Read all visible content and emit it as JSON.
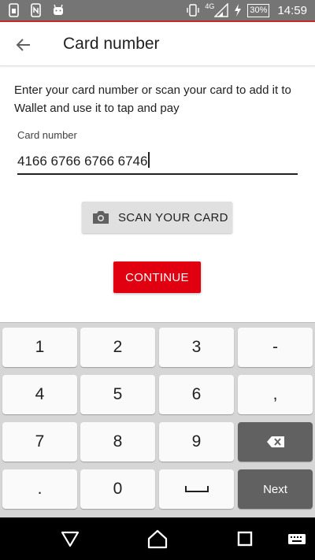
{
  "status_bar": {
    "network": "4G",
    "battery": "30%",
    "time": "14:59"
  },
  "app_bar": {
    "title": "Card number"
  },
  "content": {
    "description": "Enter your card number or scan your card to add it to Wallet and use it to tap and pay",
    "field_label": "Card number",
    "card_number_value": "4166 6766 6766 6746",
    "scan_button_label": "SCAN YOUR CARD",
    "continue_button_label": "CONTINUE"
  },
  "keyboard": {
    "rows": [
      [
        "1",
        "2",
        "3",
        "-"
      ],
      [
        "4",
        "5",
        "6",
        ","
      ],
      [
        "7",
        "8",
        "9",
        ""
      ],
      [
        ".",
        "0",
        "",
        "Next"
      ]
    ]
  },
  "colors": {
    "accent": "#e0000f",
    "status_bar": "#757575",
    "keyboard_bg": "#d6d6d6",
    "dark_key": "#616161"
  }
}
